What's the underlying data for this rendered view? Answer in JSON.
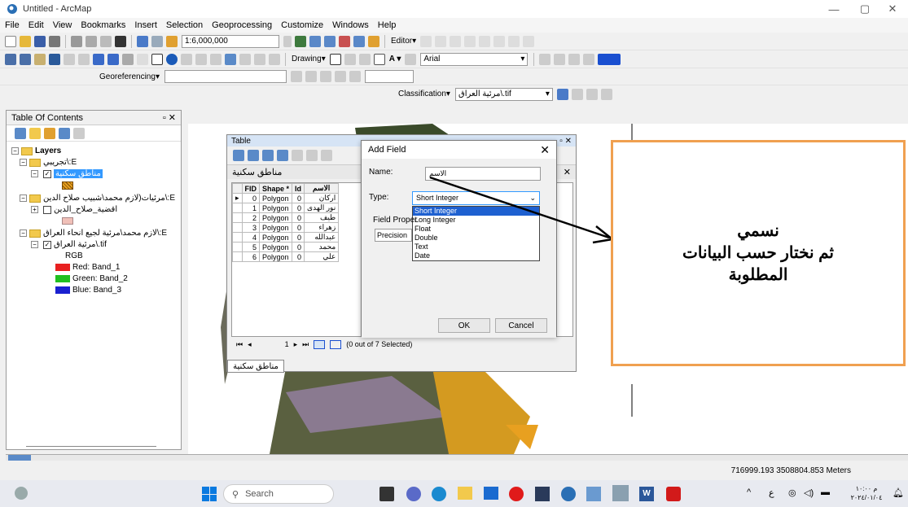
{
  "window": {
    "title": "Untitled - ArcMap"
  },
  "menu": [
    "File",
    "Edit",
    "View",
    "Bookmarks",
    "Insert",
    "Selection",
    "Geoprocessing",
    "Customize",
    "Windows",
    "Help"
  ],
  "toolbar": {
    "scale": "1:6,000,000",
    "editor_label": "Editor",
    "drawing_label": "Drawing",
    "font_name": "Arial",
    "georeferencing_label": "Georeferencing",
    "classification_label": "Classification",
    "classification_layer": "مرئية العراق\\.tif"
  },
  "toc": {
    "title": "Table Of Contents",
    "layers_label": "Layers",
    "items": [
      {
        "label": "تجريبي\\:E"
      },
      {
        "label": "مناطق سكنية"
      },
      {
        "label": "مرئيات(لازم محمد\\شبيب صلاح الدين\\:E"
      },
      {
        "label": "اقضية_صلاح_الدين"
      },
      {
        "label": "لازم محمد\\مرئية لجيع انحاء العراق\\:E"
      },
      {
        "label": "مرئية العراق\\.tif"
      },
      {
        "label": "RGB"
      },
      {
        "label": "Red:   Band_1"
      },
      {
        "label": "Green: Band_2"
      },
      {
        "label": "Blue:  Band_3"
      }
    ]
  },
  "table": {
    "window_title": "Table",
    "layer_name": "مناطق سكنية",
    "columns": [
      "FID",
      "Shape *",
      "Id",
      "الاسم"
    ],
    "rows": [
      {
        "fid": "0",
        "shape": "Polygon",
        "id": "0",
        "name": "اركان"
      },
      {
        "fid": "1",
        "shape": "Polygon",
        "id": "0",
        "name": "نور الهدى"
      },
      {
        "fid": "2",
        "shape": "Polygon",
        "id": "0",
        "name": "طيف"
      },
      {
        "fid": "3",
        "shape": "Polygon",
        "id": "0",
        "name": "زهراء"
      },
      {
        "fid": "4",
        "shape": "Polygon",
        "id": "0",
        "name": "عبدالله"
      },
      {
        "fid": "5",
        "shape": "Polygon",
        "id": "0",
        "name": "محمد"
      },
      {
        "fid": "6",
        "shape": "Polygon",
        "id": "0",
        "name": "علي"
      }
    ],
    "record_number": "1",
    "selection_status": "(0 out of 7 Selected)",
    "tab_label": "مناطق سكنية"
  },
  "dialog": {
    "title": "Add Field",
    "name_label": "Name:",
    "name_value": "الاسم",
    "type_label": "Type:",
    "type_value": "Short Integer",
    "type_options": [
      "Short Integer",
      "Long Integer",
      "Float",
      "Double",
      "Text",
      "Date"
    ],
    "field_properties_label": "Field Proper",
    "precision_label": "Precision",
    "ok_label": "OK",
    "cancel_label": "Cancel"
  },
  "annotation": {
    "line1": "نسمي",
    "line2": "ثم نختار حسب البيانات",
    "line3": "المطلوبة"
  },
  "status": {
    "coordinates": "716999.193  3508804.853 Meters"
  },
  "taskbar": {
    "search_placeholder": "Search",
    "clock_time": "م ١٠:٠٠",
    "clock_date": "٢٠٢٤/٠١/٠٤",
    "lang": "ع"
  },
  "colors": {
    "annotation_border": "#f0a050",
    "selection": "#3399ff",
    "hatch": "#e8a020"
  }
}
